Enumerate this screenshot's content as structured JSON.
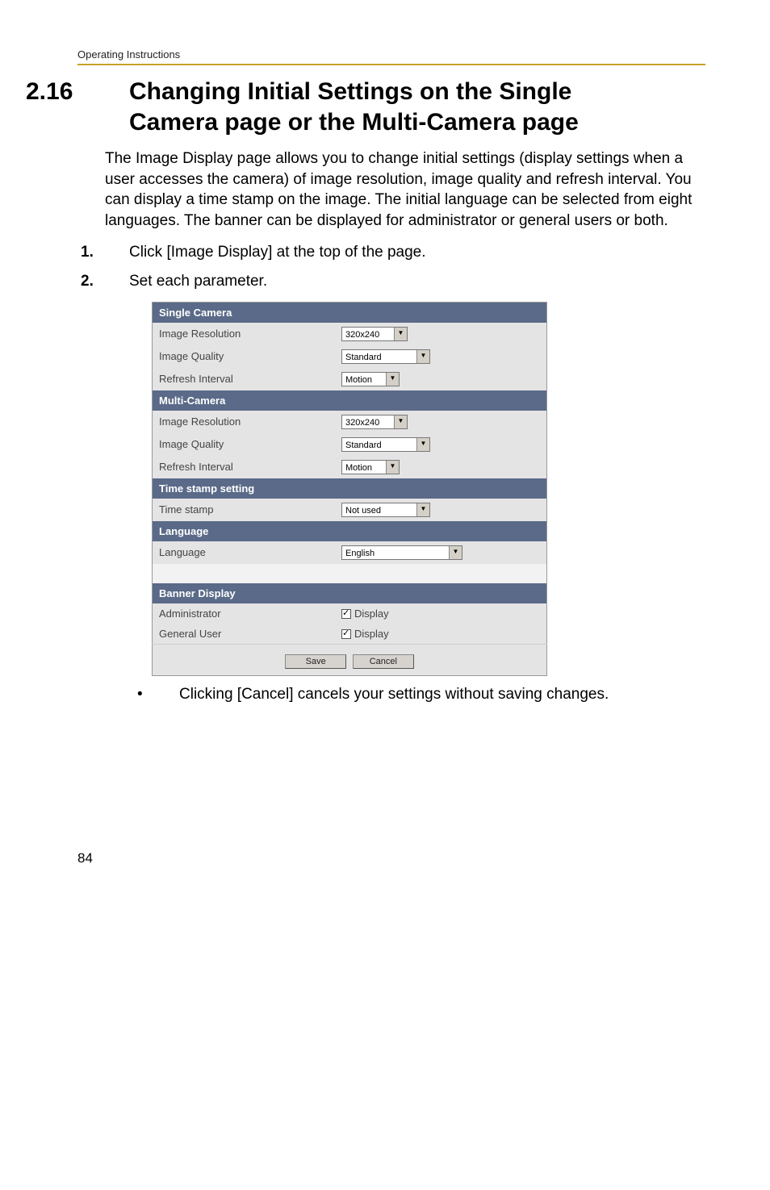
{
  "running_head": "Operating Instructions",
  "section": {
    "number": "2.16",
    "title_line1": "Changing Initial Settings on the Single",
    "title_line2": "Camera page or the Multi-Camera page"
  },
  "intro": "The Image Display page allows you to change initial settings (display settings when a user accesses the camera) of image resolution, image quality and refresh interval. You can display a time stamp on the image. The initial language can be selected from eight languages. The banner can be displayed for administrator or general users or both.",
  "steps": [
    {
      "num": "1.",
      "text": "Click [Image Display] at the top of the page."
    },
    {
      "num": "2.",
      "text": "Set each parameter."
    }
  ],
  "screenshot": {
    "groups": {
      "single_camera": {
        "header": "Single Camera",
        "rows": {
          "image_resolution": {
            "label": "Image Resolution",
            "value": "320x240"
          },
          "image_quality": {
            "label": "Image Quality",
            "value": "Standard"
          },
          "refresh_interval": {
            "label": "Refresh Interval",
            "value": "Motion"
          }
        }
      },
      "multi_camera": {
        "header": "Multi-Camera",
        "rows": {
          "image_resolution": {
            "label": "Image Resolution",
            "value": "320x240"
          },
          "image_quality": {
            "label": "Image Quality",
            "value": "Standard"
          },
          "refresh_interval": {
            "label": "Refresh Interval",
            "value": "Motion"
          }
        }
      },
      "time_stamp": {
        "header": "Time stamp setting",
        "rows": {
          "time_stamp": {
            "label": "Time stamp",
            "value": "Not used"
          }
        }
      },
      "language": {
        "header": "Language",
        "rows": {
          "language": {
            "label": "Language",
            "value": "English"
          }
        }
      },
      "banner_display": {
        "header": "Banner Display",
        "rows": {
          "administrator": {
            "label": "Administrator",
            "checkbox_label": "Display"
          },
          "general_user": {
            "label": "General User",
            "checkbox_label": "Display"
          }
        }
      }
    },
    "buttons": {
      "save": "Save",
      "cancel": "Cancel"
    }
  },
  "note": "Clicking [Cancel] cancels your settings without saving changes.",
  "page_number": "84"
}
